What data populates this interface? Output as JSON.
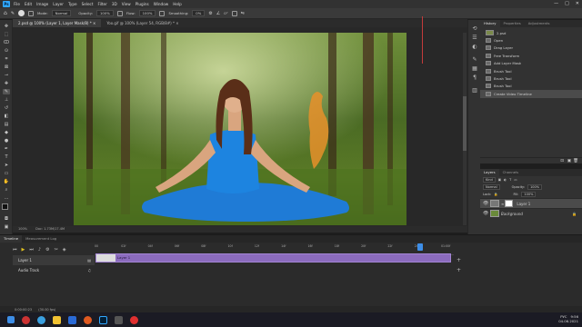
{
  "menubar": {
    "logo": "Ps",
    "items": [
      "File",
      "Edit",
      "Image",
      "Layer",
      "Type",
      "Select",
      "Filter",
      "3D",
      "View",
      "Plugins",
      "Window",
      "Help"
    ],
    "window_buttons": [
      "—",
      "□",
      "✕"
    ]
  },
  "options": {
    "mode_label": "Mode:",
    "mode_value": "Normal",
    "opacity_label": "Opacity:",
    "opacity_value": "100%",
    "flow_label": "Flow:",
    "flow_value": "100%",
    "smoothing_label": "Smoothing:",
    "smoothing_value": "0%",
    "angle_value": "0°"
  },
  "tabs": [
    {
      "label": "2.psd @ 100% (Layer 1, Layer Mask/8) *  ×",
      "active": true
    },
    {
      "label": "Yoo.gif @ 100% (Layer 54, RGB/8#) *  ×",
      "active": false
    }
  ],
  "status": {
    "zoom": "100%",
    "doc_size": "Doc: 1.73M/17.4M"
  },
  "history": {
    "tabs": [
      "History",
      "Properties",
      "Adjustments"
    ],
    "source": "2.psd",
    "items": [
      "Open",
      "Drag Layer",
      "Free Transform",
      "Add Layer Mask",
      "Brush Tool",
      "Brush Tool",
      "Brush Tool",
      "Create Video Timeline"
    ],
    "selected_index": 7
  },
  "layers": {
    "tabs": [
      "Layers",
      "Channels"
    ],
    "kind_label": "Kind",
    "blend_mode": "Normal",
    "opacity_label": "Opacity:",
    "opacity_value": "100%",
    "lock_label": "Lock:",
    "fill_label": "Fill:",
    "fill_value": "100%",
    "items": [
      {
        "name": "Layer 1",
        "selected": true
      },
      {
        "name": "Background",
        "selected": false
      }
    ]
  },
  "timeline": {
    "tabs": [
      "Timeline",
      "Measurement Log"
    ],
    "ruler_ticks": [
      "00",
      "02f",
      "04f",
      "06f",
      "08f",
      "10f",
      "12f",
      "14f",
      "16f",
      "18f",
      "20f",
      "22f",
      "24f",
      "01:00f"
    ],
    "tracks": [
      {
        "name": "Layer 1"
      },
      {
        "name": "Audio Track"
      }
    ],
    "clip_label": "Layer 1",
    "timecode": "0:00:00:23",
    "fps": "(30.00 fps)"
  },
  "taskbar": {
    "time": "9:56",
    "date": "04.06.2021",
    "lang": "РУС"
  },
  "colors": {
    "accent": "#31a8ff",
    "clip": "#8b6bbd",
    "playhead": "#3d8ee8"
  }
}
